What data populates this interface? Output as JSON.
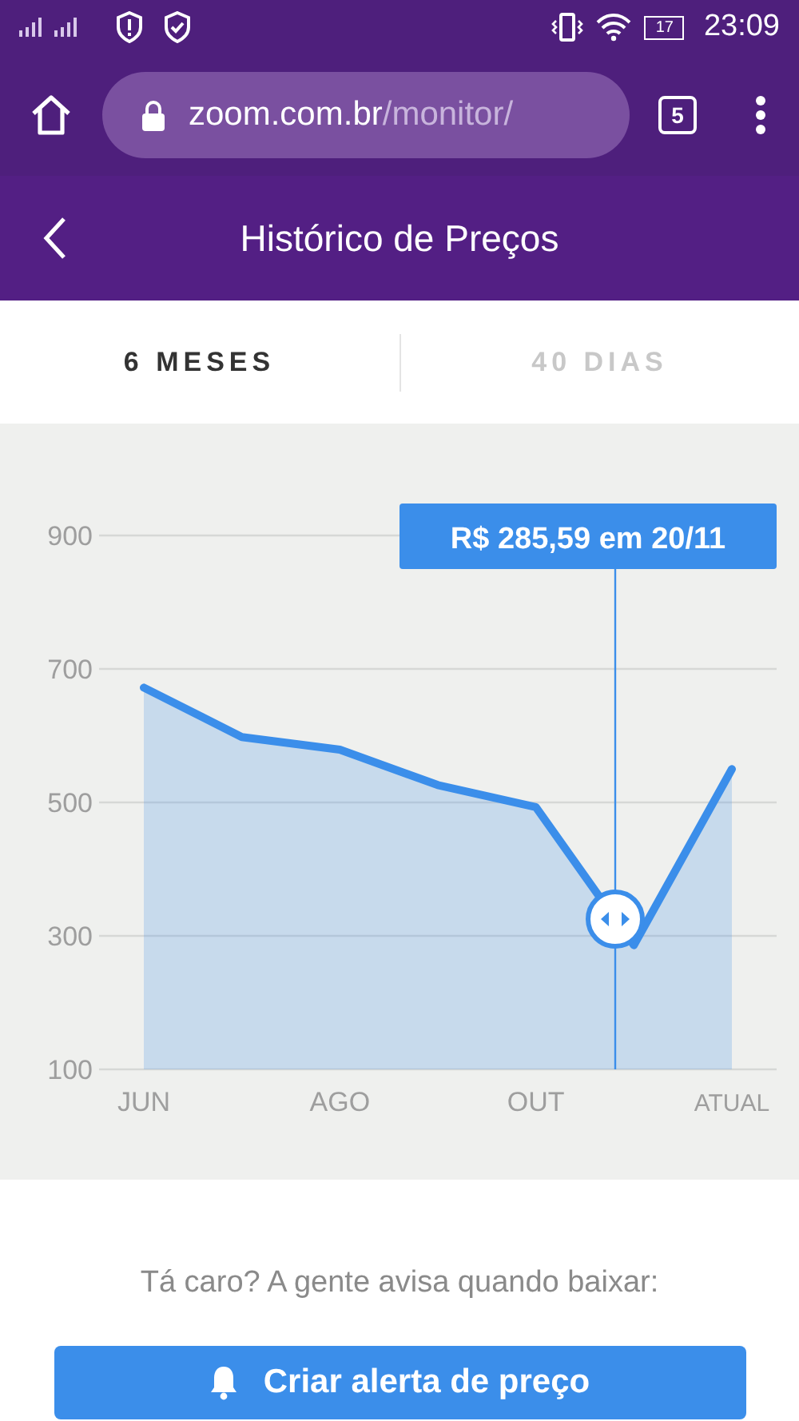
{
  "status_bar": {
    "battery": "17",
    "time": "23:09"
  },
  "browser": {
    "url_host": "zoom.com.br",
    "url_path": "/monitor/",
    "tab_count": "5"
  },
  "header": {
    "title": "Histórico de Preços"
  },
  "tabs": [
    {
      "label": "6 MESES",
      "selected": true
    },
    {
      "label": "40 DIAS",
      "selected": false
    }
  ],
  "chart": {
    "tooltip": "R$ 285,59 em 20/11",
    "chart_data": {
      "type": "area",
      "categories": [
        "JUN",
        null,
        "AGO",
        null,
        "OUT",
        null,
        "ATUAL"
      ],
      "series": [
        {
          "color": "#3b8eea",
          "values": [
            672,
            598,
            579,
            526,
            493,
            286,
            550
          ]
        }
      ],
      "ylim": [
        100,
        900
      ],
      "yticks": [
        100,
        300,
        500,
        700,
        900
      ],
      "grid": true
    }
  },
  "alert": {
    "prompt": "Tá caro? A gente avisa quando baixar:",
    "button": "Criar alerta de preço"
  }
}
